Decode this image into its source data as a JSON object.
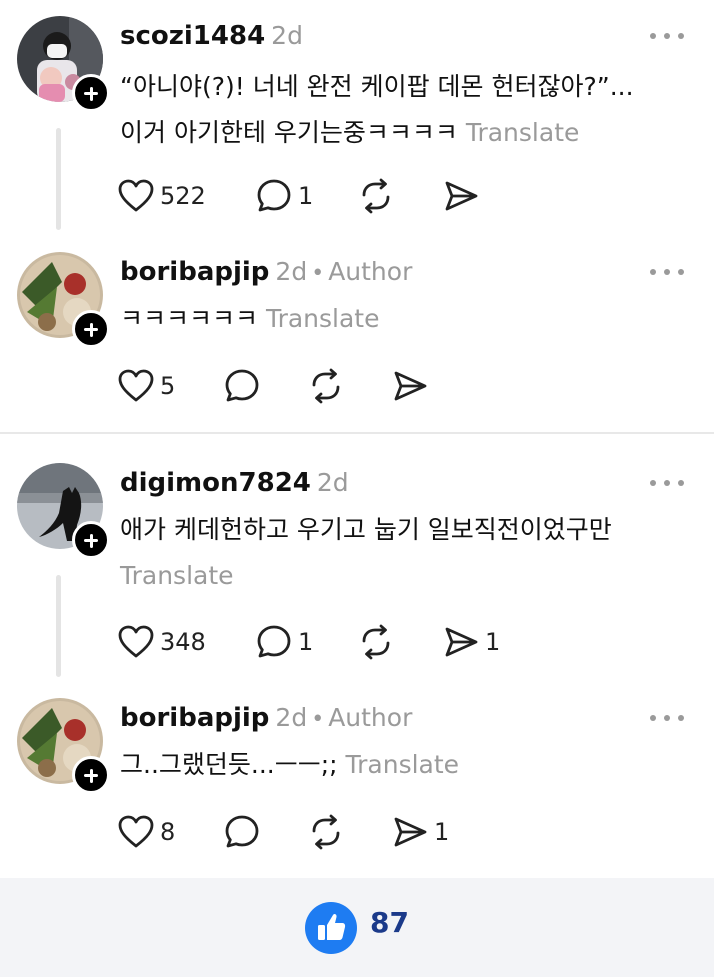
{
  "posts": [
    {
      "username": "scozi1484",
      "time": "2d",
      "author_label": "",
      "lines": [
        "“아니야(?)! 너네 완전 케이팝 데몬 헌터잖아?”...",
        "이거 아기한테 우기는중ㅋㅋㅋㅋ"
      ],
      "translate": "Translate",
      "likes": "522",
      "replies": "1",
      "shares": ""
    },
    {
      "username": "boribapjip",
      "time": "2d",
      "author_label": "Author",
      "lines": [
        "ㅋㅋㅋㅋㅋㅋ"
      ],
      "translate": "Translate",
      "likes": "5",
      "replies": "",
      "shares": ""
    },
    {
      "username": "digimon7824",
      "time": "2d",
      "author_label": "",
      "lines": [
        "애가 케데헌하고 우기고 눕기 일보직전이었구만"
      ],
      "translate": "Translate",
      "likes": "348",
      "replies": "1",
      "shares": "1"
    },
    {
      "username": "boribapjip",
      "time": "2d",
      "author_label": "Author",
      "lines": [
        "그..그랬던듯...ㅡㅡ;;"
      ],
      "translate": "Translate",
      "likes": "8",
      "replies": "",
      "shares": "1"
    }
  ],
  "icons": {
    "like": "heart-icon",
    "reply": "comment-icon",
    "repost": "repost-icon",
    "share": "send-icon",
    "more": "more-dots-icon",
    "follow": "plus-icon",
    "reaction": "thumbs-up-icon"
  },
  "bottom_bar": {
    "reaction_count": "87"
  },
  "colors": {
    "muted": "#9a9a9a",
    "reaction_blue": "#1e7cf2",
    "count_navy": "#1b3a8a"
  }
}
